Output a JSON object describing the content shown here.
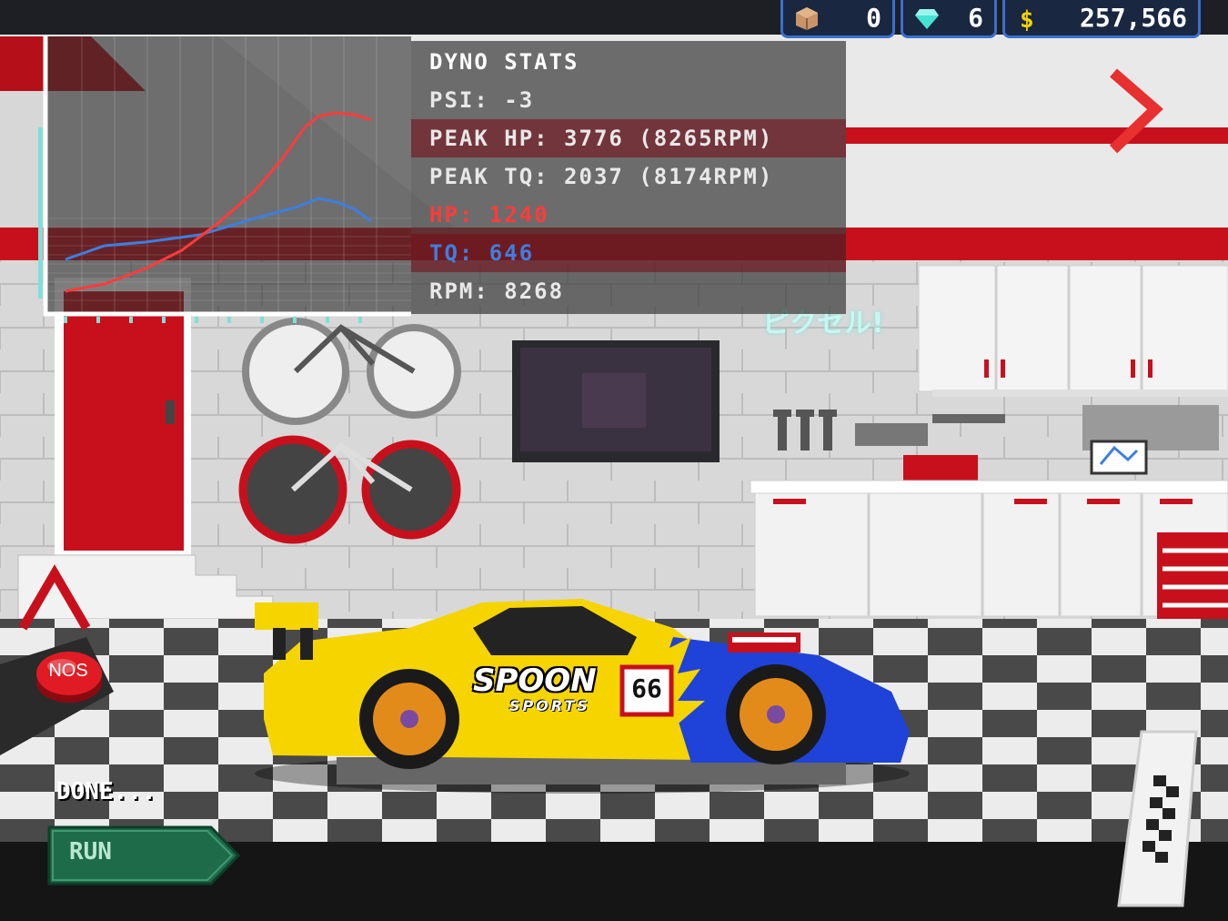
{
  "resources": {
    "crates": "0",
    "gems": "6",
    "money": "257,566"
  },
  "dyno": {
    "title": "DYNO STATS",
    "psi": "PSI: -3",
    "peak_hp": "PEAK HP: 3776 (8265RPM)",
    "peak_tq": "PEAK TQ: 2037 (8174RPM)",
    "hp": "HP: 1240",
    "tq": "TQ: 646",
    "rpm": "RPM: 8268"
  },
  "wall_sign": "ピクセル!",
  "car": {
    "brand_text": "SPOON",
    "brand_sub": "SPORTS",
    "number": "66"
  },
  "controls": {
    "nos_label": "NOS",
    "status_text": "DONE...",
    "run_label": "RUN"
  },
  "colors": {
    "hp_curve": "#ff3b3b",
    "tq_curve": "#3d7fe0",
    "garage_red": "#c8101c",
    "car_yellow": "#f5d400",
    "car_blue": "#1f43d8",
    "run_button": "#1e6b4a"
  }
}
